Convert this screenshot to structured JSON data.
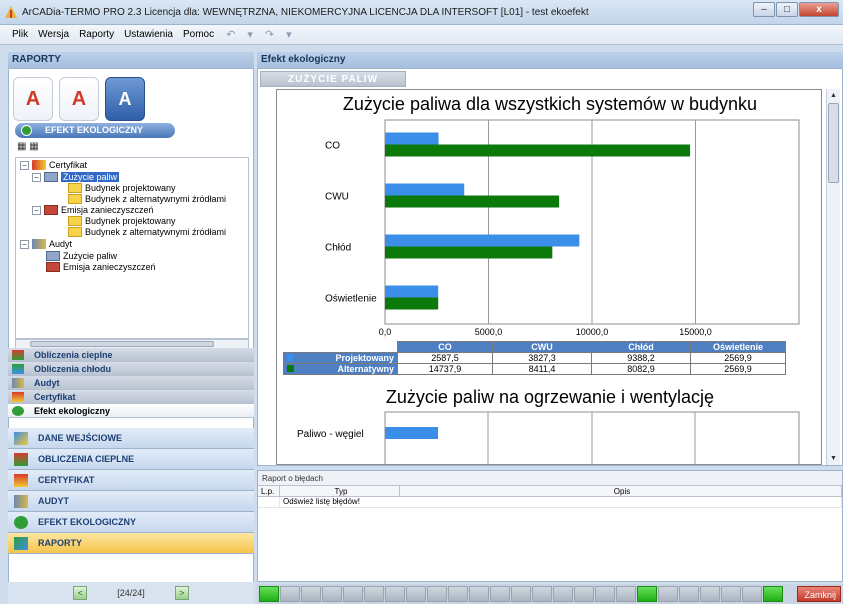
{
  "window": {
    "title": "ArCADia-TERMO PRO 2.3 Licencja dla: WEWNĘTRZNA, NIEKOMERCYJNA LICENCJA DLA INTERSOFT [L01] - test ekoefekt",
    "close_label": "x"
  },
  "menu": [
    "Plik",
    "Wersja",
    "Raporty",
    "Ustawienia",
    "Pomoc"
  ],
  "left": {
    "header": "RAPORTY",
    "eko_button": "EFEKT EKOLOGICZNY",
    "tree": {
      "certyfikat": "Certyfikat",
      "zuzycie_paliw": "Zużycie paliw",
      "budynek_proj": "Budynek projektowany",
      "budynek_alt": "Budynek z alternatywnymi źródłami",
      "emisja": "Emisja zanieczyszczeń",
      "budynek_proj2": "Budynek projektowany",
      "budynek_alt2": "Budynek z alternatywnymi źródłami",
      "audyt": "Audyt",
      "zuzycie_paliw2": "Zużycie paliw",
      "emisja2": "Emisja zanieczyszczeń"
    },
    "small_tabs": [
      "Obliczenia cieplne",
      "Obliczenia chłodu",
      "Audyt",
      "Certyfikat",
      "Efekt ekologiczny"
    ],
    "big_tabs": [
      "DANE WEJŚCIOWE",
      "OBLICZENIA CIEPLNE",
      "CERTYFIKAT",
      "AUDYT",
      "EFEKT EKOLOGICZNY",
      "RAPORTY"
    ],
    "pager": "[24/24]"
  },
  "right": {
    "header": "Efekt ekologiczny",
    "tab": "ZUŻYCIE PALIW",
    "chart1_title": "Zużycie paliwa dla wszystkich systemów w budynku",
    "chart2_title": "Zużycie paliw na ogrzewanie i wentylację",
    "chart2_first_label": "Paliwo - węgiel",
    "errors": {
      "title": "Raport o błędach",
      "cols": [
        "L.p.",
        "Typ",
        "Opis"
      ],
      "row": "Odśwież listę błędów!"
    },
    "close_button": "Zamknij"
  },
  "chart_data": [
    {
      "type": "bar",
      "orientation": "horizontal",
      "title": "Zużycie paliwa dla wszystkich systemów w budynku",
      "categories": [
        "CO",
        "CWU",
        "Chłód",
        "Oświetlenie"
      ],
      "series": [
        {
          "name": "Projektowany",
          "values": [
            2587.5,
            3827.3,
            9388.2,
            2569.9
          ],
          "color": "#3b8fe8"
        },
        {
          "name": "Alternatywny",
          "values": [
            14737.9,
            8411.4,
            8082.9,
            2569.9
          ],
          "color": "#0b7a0b"
        }
      ],
      "table_values": {
        "Projektowany": [
          "2587,5",
          "3827,3",
          "9388,2",
          "2569,9"
        ],
        "Alternatywny": [
          "14737,9",
          "8411,4",
          "8082,9",
          "2569,9"
        ]
      },
      "xlim": [
        0,
        20000
      ],
      "xticks": [
        "0,0",
        "5000,0",
        "10000,0",
        "15000,0"
      ],
      "grid": true
    }
  ]
}
